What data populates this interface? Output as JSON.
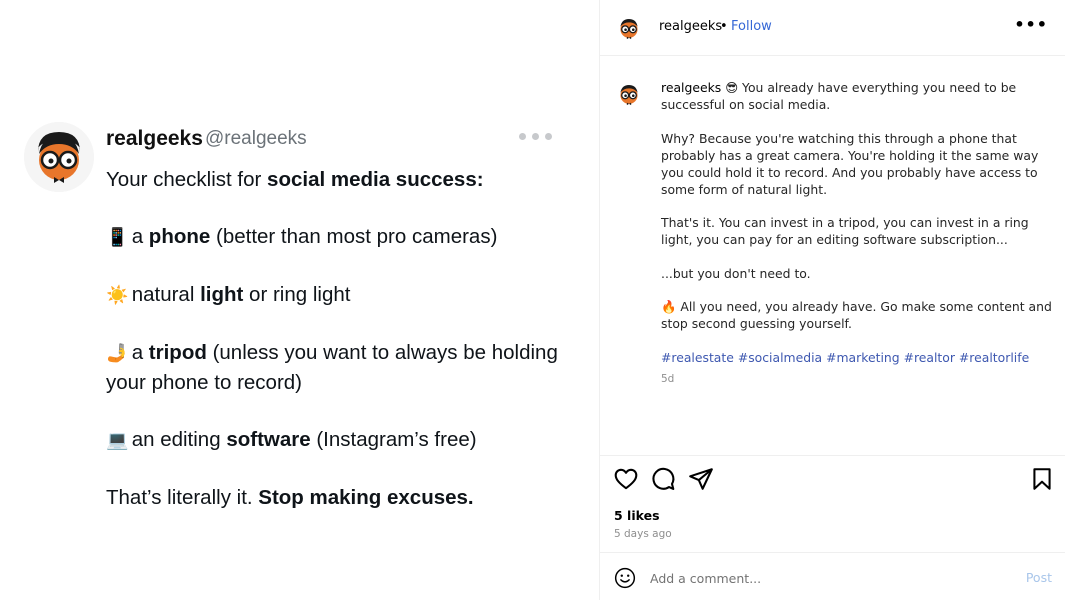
{
  "tweet": {
    "name": "realgeeks",
    "handle": "@realgeeks",
    "line1_plain": "Your checklist for ",
    "line1_bold": "social media success:",
    "item_phone": {
      "emoji": "📱",
      "pre": " a ",
      "bold": "phone",
      "post": " (better than most pro cameras)"
    },
    "item_light": {
      "emoji": "☀️",
      "pre": " natural ",
      "bold": "light",
      "post": " or ring light"
    },
    "item_tripod": {
      "emoji": "🤳",
      "pre": " a ",
      "bold": "tripod",
      "post": " (unless you want to always be holding your phone to record)"
    },
    "item_software": {
      "emoji": "💻",
      "pre": " an editing ",
      "bold": "software",
      "post": " (Instagram’s free)"
    },
    "closing_plain": "That’s literally it. ",
    "closing_bold": "Stop making excuses."
  },
  "header": {
    "username": "realgeeks",
    "dot": "•",
    "follow": "Follow",
    "menu": "•••"
  },
  "caption": {
    "username": "realgeeks",
    "emoji_1": "😎",
    "p1": " You already have everything you need to be successful on social media.",
    "p2": "Why? Because you're watching this through a phone that probably has a great camera. You're holding it the same way you could hold it to record. And you probably have access to some form of natural light.",
    "p3": "That's it. You can invest in a tripod, you can invest in a ring light, you can pay for an editing software subscription...",
    "p4": "...but you don't need to.",
    "emoji_2": "🔥",
    "p5": " All you need, you already have. Go make some content and stop second guessing yourself.",
    "hashtags": [
      "#realestate",
      "#socialmedia",
      "#marketing",
      "#realtor",
      "#realtorlife"
    ],
    "age": "5d"
  },
  "engagement": {
    "likes": "5 likes",
    "ago": "5 days ago"
  },
  "comment": {
    "placeholder": "Add a comment...",
    "post": "Post"
  },
  "icons": {
    "like": "heart-icon",
    "comment": "comment-icon",
    "share": "share-icon",
    "save": "bookmark-icon",
    "emoji": "smiley-icon"
  },
  "colors": {
    "follow": "#3567d6",
    "hashtag": "#3e58b0",
    "post_disabled": "#a9c6ea",
    "avatar_face": "#e8762b"
  }
}
